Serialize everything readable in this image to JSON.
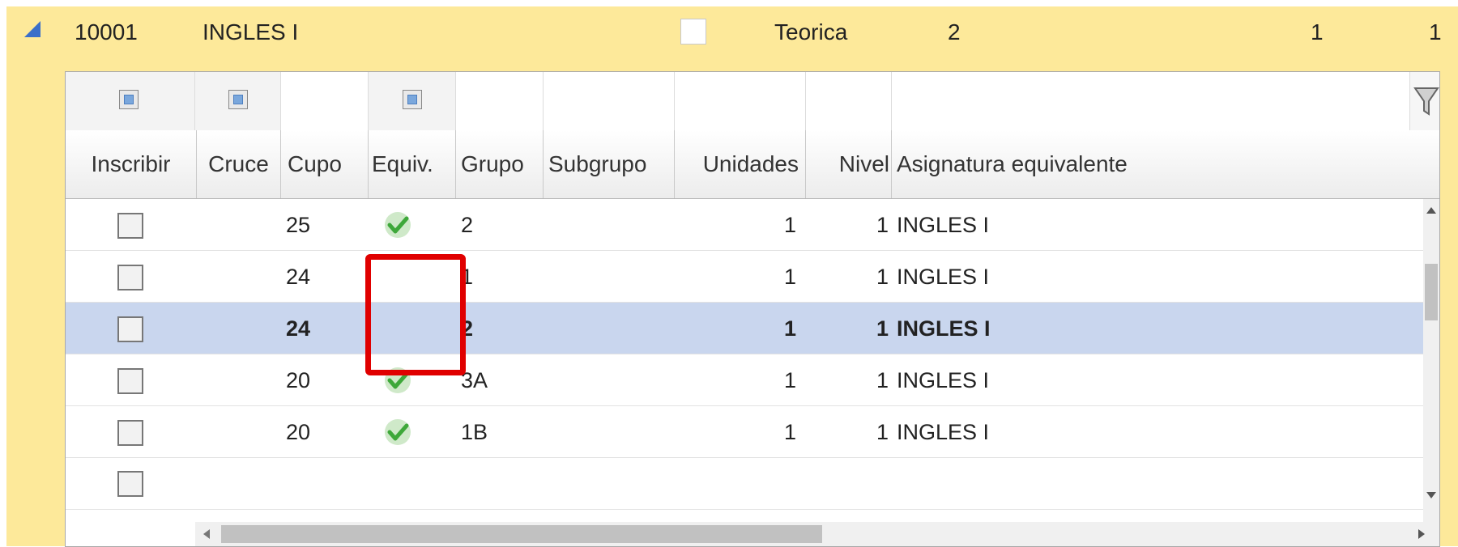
{
  "parent_row": {
    "code": "10001",
    "name": "INGLES I",
    "type": "Teorica",
    "value1": "2",
    "value2": "1",
    "value3": "1"
  },
  "grid": {
    "columns": [
      "Inscribir",
      "Cruce",
      "Cupo",
      "Equiv.",
      "Grupo",
      "Subgrupo",
      "Unidades",
      "Nivel",
      "Asignatura equivalente"
    ],
    "rows": [
      {
        "cupo": "25",
        "equiv": true,
        "grupo": "2",
        "unidades": "1",
        "nivel": "1",
        "asignatura": "INGLES I"
      },
      {
        "cupo": "24",
        "equiv": false,
        "grupo": "1",
        "unidades": "1",
        "nivel": "1",
        "asignatura": "INGLES I"
      },
      {
        "cupo": "24",
        "equiv": false,
        "grupo": "2",
        "unidades": "1",
        "nivel": "1",
        "asignatura": "INGLES I",
        "selected": true
      },
      {
        "cupo": "20",
        "equiv": true,
        "grupo": "3A",
        "unidades": "1",
        "nivel": "1",
        "asignatura": "INGLES I"
      },
      {
        "cupo": "20",
        "equiv": true,
        "grupo": "1B",
        "unidades": "1",
        "nivel": "1",
        "asignatura": "INGLES I"
      }
    ]
  },
  "icons": {
    "expander": "collapse-triangle-icon",
    "filter": "funnel-icon",
    "equiv_ok": "green-check-icon"
  },
  "colors": {
    "panel_bg": "#fde99a",
    "selected_row": "#c9d6ee",
    "highlight": "#e00000"
  }
}
